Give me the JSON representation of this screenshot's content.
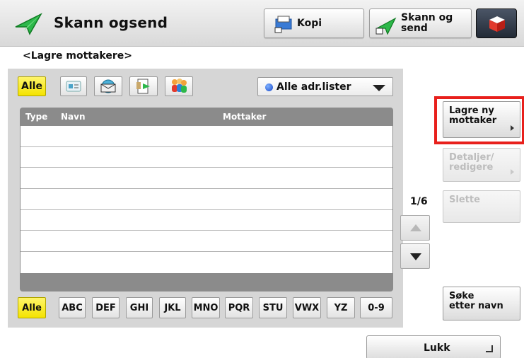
{
  "header": {
    "app_title": "Skann ogsend",
    "app_icon": "send-arrow-icon",
    "buttons": [
      {
        "label": "Kopi",
        "icon": "copy-icon"
      },
      {
        "label_line1": "Skann og",
        "label_line2": "send",
        "icon": "send-arrow-icon"
      },
      {
        "icon": "cube-menu-icon"
      }
    ]
  },
  "subtitle": "<Lagre mottakere>",
  "filters": {
    "categories": [
      {
        "label": "Alle",
        "active": true
      },
      {
        "icon": "address-card-icon"
      },
      {
        "icon": "email-globe-icon"
      },
      {
        "icon": "fax-document-icon"
      },
      {
        "icon": "group-people-icon"
      }
    ],
    "address_list": "Alle adr.lister"
  },
  "list": {
    "columns": [
      "Type",
      "Navn",
      "Mottaker"
    ],
    "rows": []
  },
  "alpha_index": [
    "Alle",
    "ABC",
    "DEF",
    "GHI",
    "JKL",
    "MNO",
    "PQR",
    "STU",
    "VWX",
    "YZ",
    "0-9"
  ],
  "pagination": {
    "page": "1/6"
  },
  "side_buttons": {
    "store_new": "Lagre ny\nmottaker",
    "details": "Detaljer/\nredigere",
    "delete": "Slette",
    "search": "Søke\netter navn"
  },
  "close_label": "Lukk",
  "colors": {
    "active_yellow": "#f4e300",
    "highlight_red": "#e8201c",
    "list_header": "#8b8b8b"
  }
}
